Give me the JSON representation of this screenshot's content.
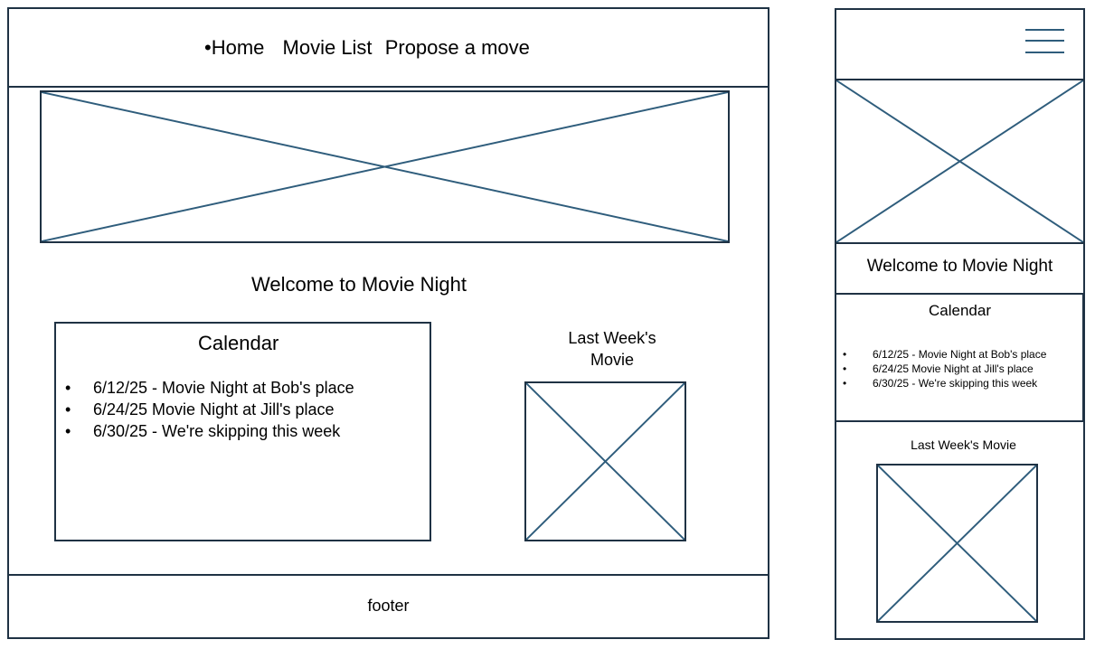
{
  "desktop": {
    "nav": {
      "bullet": "•",
      "items": [
        "Home",
        "Movie List",
        "Propose a move"
      ]
    },
    "welcome": "Welcome to Movie Night",
    "calendar": {
      "title": "Calendar",
      "items": [
        "6/12/25 - Movie Night at Bob's place",
        "6/24/25 Movie Night at Jill's place",
        "6/30/25 - We're skipping this week"
      ]
    },
    "last_week": {
      "line1": "Last Week's",
      "line2": "Movie"
    },
    "footer": "footer"
  },
  "mobile": {
    "welcome": "Welcome to Movie Night",
    "calendar": {
      "title": "Calendar",
      "items": [
        "6/12/25 - Movie Night at Bob's place",
        "6/24/25 Movie Night at Jill's place",
        "6/30/25 - We're skipping this week"
      ]
    },
    "last_week": "Last Week's Movie"
  },
  "colors": {
    "frame_border": "#1f3244",
    "placeholder_line": "#2f5d7c",
    "text": "#000000"
  },
  "icons": {
    "menu": "hamburger-menu-icon",
    "image_placeholder": "image-placeholder-icon"
  }
}
